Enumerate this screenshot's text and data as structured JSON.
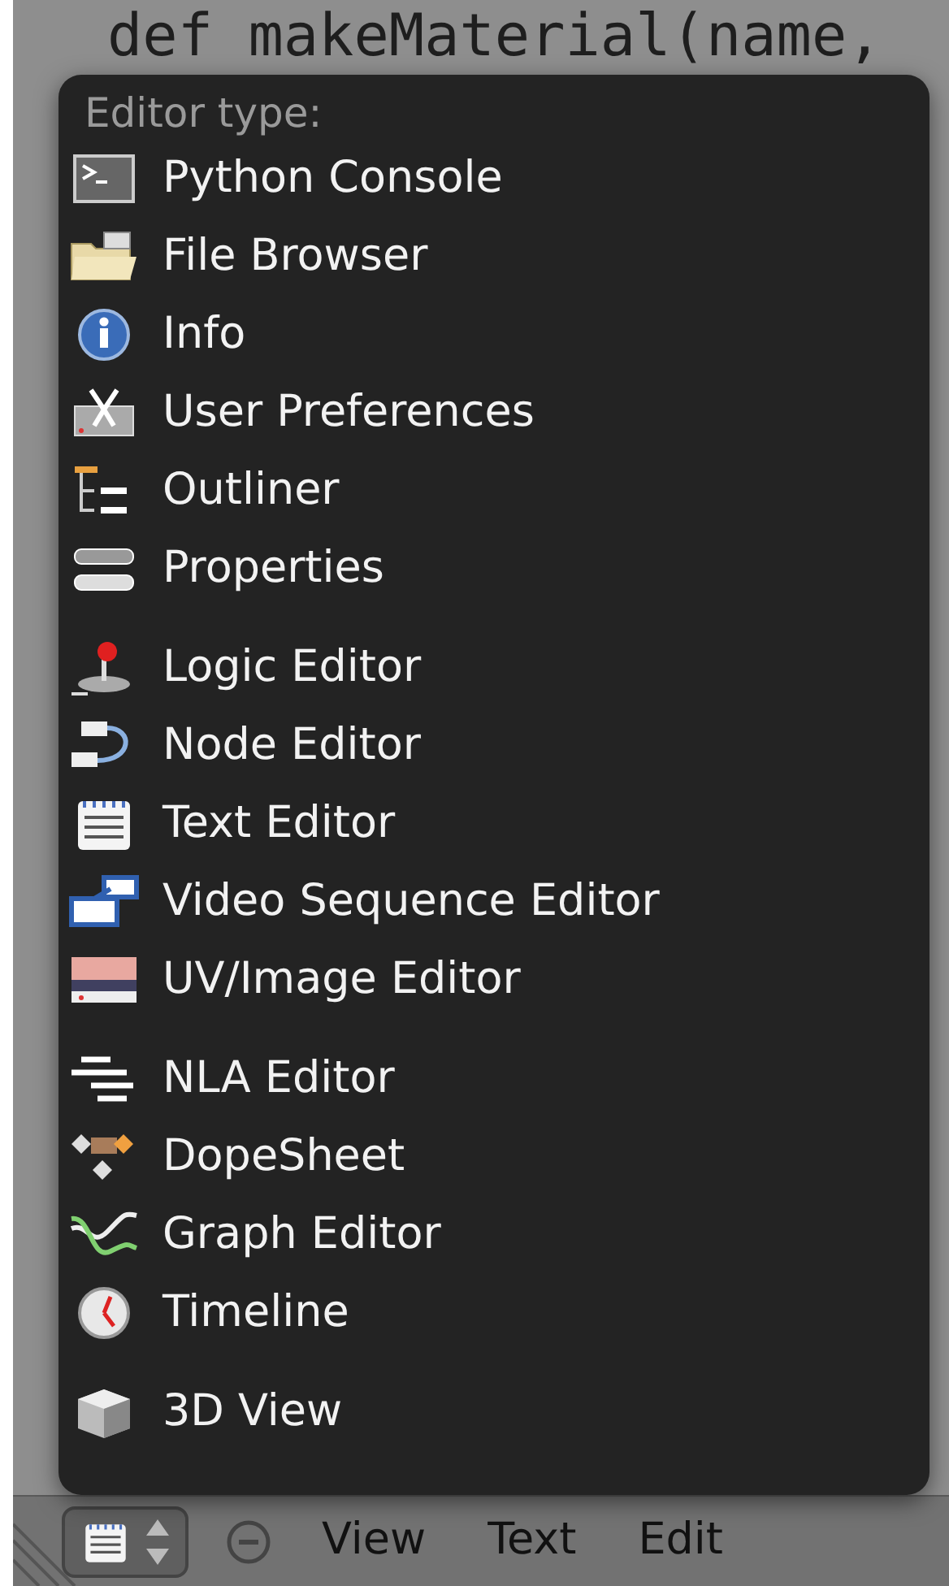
{
  "code_lines": [
    "def makeMaterial(name,"
  ],
  "menu": {
    "title": "Editor type:",
    "items": [
      {
        "kind": "entry",
        "label": "Python Console"
      },
      {
        "kind": "entry",
        "label": "File Browser"
      },
      {
        "kind": "entry",
        "label": "Info"
      },
      {
        "kind": "entry",
        "label": "User Preferences"
      },
      {
        "kind": "entry",
        "label": "Outliner"
      },
      {
        "kind": "entry",
        "label": "Properties"
      },
      {
        "kind": "separator"
      },
      {
        "kind": "entry",
        "label": "Logic Editor"
      },
      {
        "kind": "entry",
        "label": "Node Editor"
      },
      {
        "kind": "entry",
        "label": "Text Editor"
      },
      {
        "kind": "entry",
        "label": "Video Sequence Editor"
      },
      {
        "kind": "entry",
        "label": "UV/Image Editor"
      },
      {
        "kind": "separator"
      },
      {
        "kind": "entry",
        "label": "NLA Editor"
      },
      {
        "kind": "entry",
        "label": "DopeSheet"
      },
      {
        "kind": "entry",
        "label": "Graph Editor"
      },
      {
        "kind": "entry",
        "label": "Timeline"
      },
      {
        "kind": "separator"
      },
      {
        "kind": "entry",
        "label": "3D View"
      }
    ]
  },
  "header": {
    "menus": [
      "View",
      "Text",
      "Edit"
    ]
  }
}
